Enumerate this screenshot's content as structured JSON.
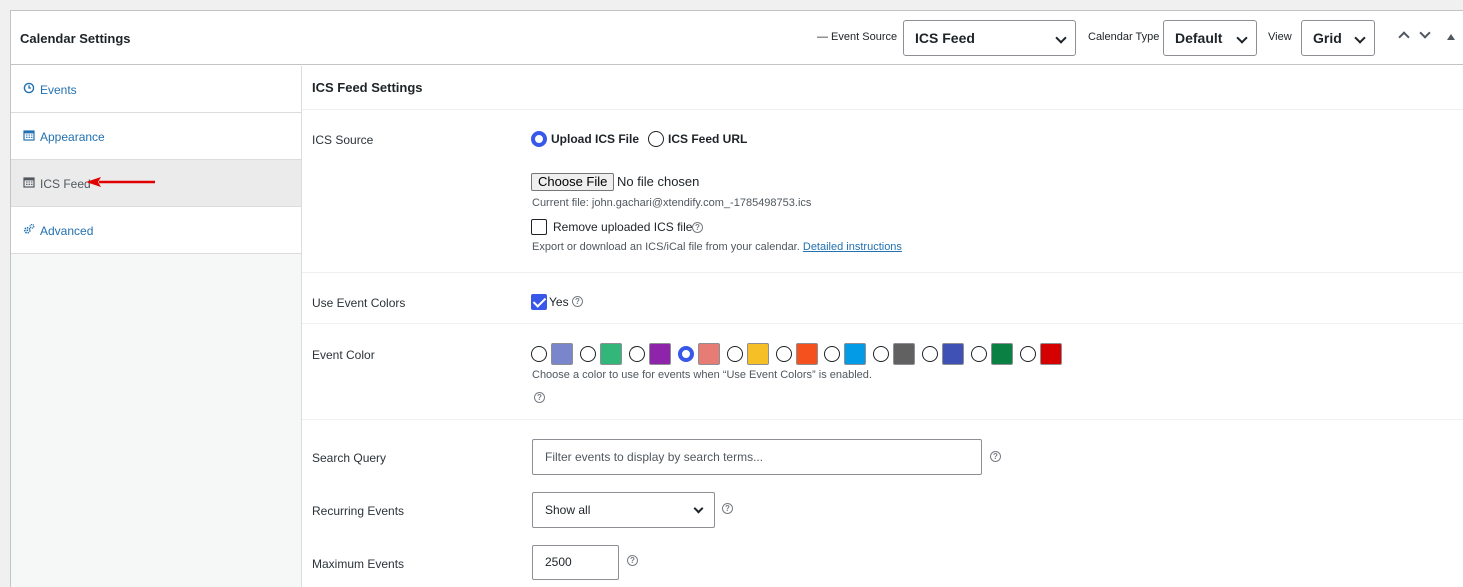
{
  "header": {
    "title": "Calendar Settings",
    "event_source_label": "— Event Source",
    "event_source_value": "ICS Feed",
    "calendar_type_label": "Calendar Type",
    "calendar_type_value": "Default",
    "view_label": "View",
    "view_value": "Grid"
  },
  "sidebar": {
    "items": [
      {
        "label": "Events",
        "icon": "clock-icon"
      },
      {
        "label": "Appearance",
        "icon": "calendar-icon"
      },
      {
        "label": "ICS Feed",
        "icon": "calendar-icon",
        "active": true
      },
      {
        "label": "Advanced",
        "icon": "gears-icon"
      }
    ]
  },
  "main": {
    "section_title": "ICS Feed Settings",
    "ics_source": {
      "label": "ICS Source",
      "option_upload": "Upload ICS File",
      "option_url": "ICS Feed URL",
      "selected": "Upload ICS File",
      "choose_file": "Choose File",
      "no_file": "No file chosen",
      "current_file": "Current file: john.gachari@xtendify.com_-1785498753.ics",
      "remove_label": "Remove uploaded ICS file",
      "export_note": "Export or download an ICS/iCal file from your calendar.",
      "instructions_link": "Detailed instructions"
    },
    "use_event_colors": {
      "label": "Use Event Colors",
      "checkbox_label": "Yes",
      "checked": true
    },
    "event_color": {
      "label": "Event Color",
      "colors": [
        "#7986cb",
        "#33b679",
        "#8e24aa",
        "#e67c73",
        "#f6bf26",
        "#f4511e",
        "#039be5",
        "#616161",
        "#3f51b5",
        "#0b8043",
        "#d50000"
      ],
      "selected_index": 3,
      "help_text": "Choose a color to use for events when “Use Event Colors” is enabled."
    },
    "search_query": {
      "label": "Search Query",
      "placeholder": "Filter events to display by search terms..."
    },
    "recurring_events": {
      "label": "Recurring Events",
      "value": "Show all"
    },
    "maximum_events": {
      "label": "Maximum Events",
      "value": "2500"
    }
  }
}
